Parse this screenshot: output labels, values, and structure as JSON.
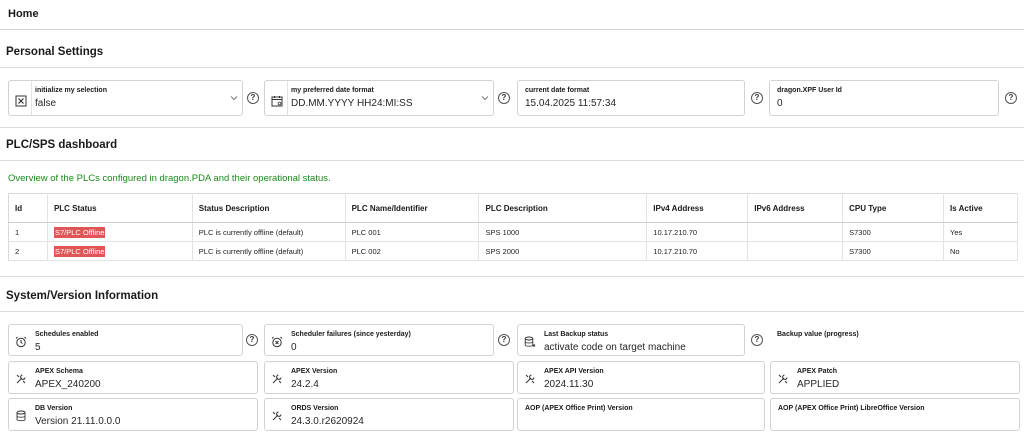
{
  "breadcrumb": {
    "home": "Home"
  },
  "personal": {
    "title": "Personal Settings",
    "fields": [
      {
        "label": "initialize my selection",
        "value": "false",
        "icon": "checkbox-x-icon",
        "select": true
      },
      {
        "label": "my preferred date format",
        "value": "DD.MM.YYYY HH24:MI:SS",
        "icon": "calendar-icon",
        "select": true
      },
      {
        "label": "current date format",
        "value": "15.04.2025 11:57:34"
      },
      {
        "label": "dragon.XPF User Id",
        "value": "0"
      }
    ]
  },
  "dashboard": {
    "title": "PLC/SPS dashboard",
    "description": "Overview of the PLCs configured in dragon.PDA and their operational status.",
    "columns": [
      "Id",
      "PLC Status",
      "Status Description",
      "PLC Name/Identifier",
      "PLC Description",
      "IPv4 Address",
      "IPv6 Address",
      "CPU Type",
      "Is Active"
    ],
    "rows": [
      [
        "1",
        "S7/PLC Offline",
        "PLC is currently offline (default)",
        "PLC 001",
        "SPS 1000",
        "10.17.210.70",
        "",
        "S7300",
        "Yes"
      ],
      [
        "2",
        "S7/PLC Offline",
        "PLC is currently offline (default)",
        "PLC 002",
        "SPS 2000",
        "10.17.210.70",
        "",
        "S7300",
        "No"
      ]
    ],
    "status_color": "#e05555"
  },
  "system": {
    "title": "System/Version Information",
    "fields": [
      {
        "label": "Schedules enabled",
        "value": "5",
        "icon": "alarm-clock-icon"
      },
      {
        "label": "Scheduler failures (since yesterday)",
        "value": "0",
        "icon": "alarm-clock-icon"
      },
      {
        "label": "Last Backup status",
        "value": "activate code on target machine",
        "icon": "database-backup-icon"
      },
      {
        "label": "Backup value (progress)",
        "value": ""
      },
      {
        "label": "APEX Schema",
        "value": "APEX_240200",
        "icon": "wrench-icon"
      },
      {
        "label": "APEX Version",
        "value": "24.2.4",
        "icon": "wrench-icon"
      },
      {
        "label": "APEX API Version",
        "value": "2024.11.30",
        "icon": "wrench-icon"
      },
      {
        "label": "APEX Patch",
        "value": "APPLIED",
        "icon": "wrench-icon"
      },
      {
        "label": "DB Version",
        "value": "Version 21.11.0.0.0",
        "icon": "database-icon"
      },
      {
        "label": "ORDS Version",
        "value": "24.3.0.r2620924",
        "icon": "wrench-icon"
      },
      {
        "label": "AOP (APEX Office Print) Version",
        "value": ""
      },
      {
        "label": "AOP (APEX Office Print) LibreOffice Version",
        "value": ""
      }
    ]
  },
  "help_glyph": "?"
}
